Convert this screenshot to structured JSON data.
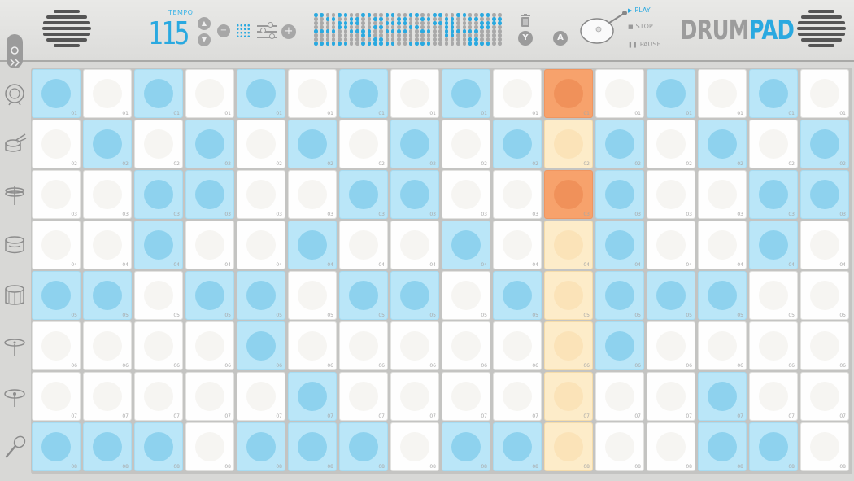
{
  "tempo": {
    "label": "TEMPO",
    "value": "115"
  },
  "controls": {
    "tempo_up": "▲",
    "tempo_down": "▼",
    "minus": "−",
    "plus": "+",
    "y_button": "Y",
    "a_button": "A"
  },
  "transport": {
    "play": "PLAY",
    "stop": "STOP",
    "pause": "PAUSE",
    "active": "play"
  },
  "logo": {
    "part1": "DRUM",
    "part2": "PAD"
  },
  "colors": {
    "accent": "#2aa9e0",
    "pad_on": "#bae6f8",
    "playhead": "#f7a26c",
    "playhead_dim": "#fdecc9"
  },
  "instruments": [
    "bass-drum-icon",
    "snare-drum-icon",
    "hi-hat-icon",
    "tom-drum-icon",
    "floor-tom-icon",
    "cymbal-icon",
    "ride-cymbal-icon",
    "maraca-icon"
  ],
  "row_numbers": [
    "01",
    "02",
    "03",
    "04",
    "05",
    "06",
    "07",
    "08"
  ],
  "playhead_step": 11,
  "pattern": [
    "1010101010101010",
    "0101010101010101",
    "0011001100110011",
    "0010010010010010",
    "1101101101011100",
    "0000100000010000",
    "0000010000000100",
    "1110111011000110"
  ]
}
